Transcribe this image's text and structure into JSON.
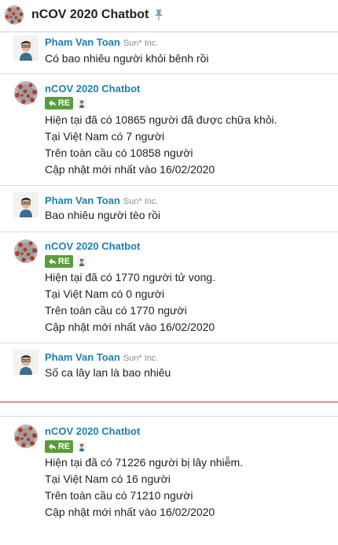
{
  "header": {
    "title": "nCOV 2020 Chatbot",
    "logo_icon": "virus-icon",
    "pin_icon": "pin-icon"
  },
  "messages": [
    {
      "sender": "Pham Van Toan",
      "org": "Sun* Inc.",
      "lines": [
        "Có bao nhiêu người khỏi bênh rồi"
      ]
    },
    {
      "sender": "nCOV 2020 Chatbot",
      "reply_label": "RE",
      "lines": [
        "Hiện tại đã có 10865 người đã được chữa khỏi.",
        "Tại Việt Nam có 7 người",
        "Trên toàn cầu có 10858 người",
        "Cập nhật mới nhất vào 16/02/2020"
      ]
    },
    {
      "sender": "Pham Van Toan",
      "org": "Sun* Inc.",
      "lines": [
        "Bao nhiêu người tèo rồi"
      ]
    },
    {
      "sender": "nCOV 2020 Chatbot",
      "reply_label": "RE",
      "lines": [
        "Hiện tại đã có 1770 người tử vong.",
        "Tại Việt Nam có 0 người",
        "Trên toàn cầu có 1770 người",
        "Cập nhật mới nhất vào 16/02/2020"
      ]
    },
    {
      "sender": "Pham Van Toan",
      "org": "Sun* Inc.",
      "lines": [
        "Số ca lây lan là bao nhiêu"
      ]
    },
    {
      "sender": "nCOV 2020 Chatbot",
      "reply_label": "RE",
      "lines": [
        "Hiện tại đã có 71226 người bị lây nhiễm.",
        "Tại Việt Nam có 16 người",
        "Trên toàn cầu có 71210 người",
        "Cập nhật mới nhất vào 16/02/2020"
      ]
    }
  ],
  "colors": {
    "sender": "#1f7fb0",
    "reply_badge": "#5a9e3b",
    "new_divider": "#c62828"
  }
}
